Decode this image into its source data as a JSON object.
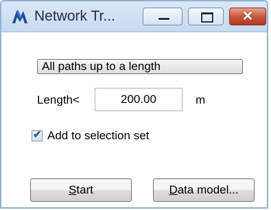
{
  "window": {
    "title": "Network Tr...",
    "app_icon": "network-trace-app-icon"
  },
  "caption_buttons": {
    "minimize_icon": "minimize-icon",
    "maximize_icon": "maximize-icon",
    "close_icon": "close-icon",
    "close_glyph": "✕",
    "close_color": "#c75a3f"
  },
  "mode": {
    "label": "All paths up to a length"
  },
  "length": {
    "label": "Length<",
    "value": "200.00",
    "unit": "m"
  },
  "selection": {
    "checked": true,
    "label": "Add to selection set"
  },
  "buttons": {
    "start_accel": "S",
    "start_rest": "tart",
    "datamodel_accel": "D",
    "datamodel_rest": "ata model..."
  }
}
